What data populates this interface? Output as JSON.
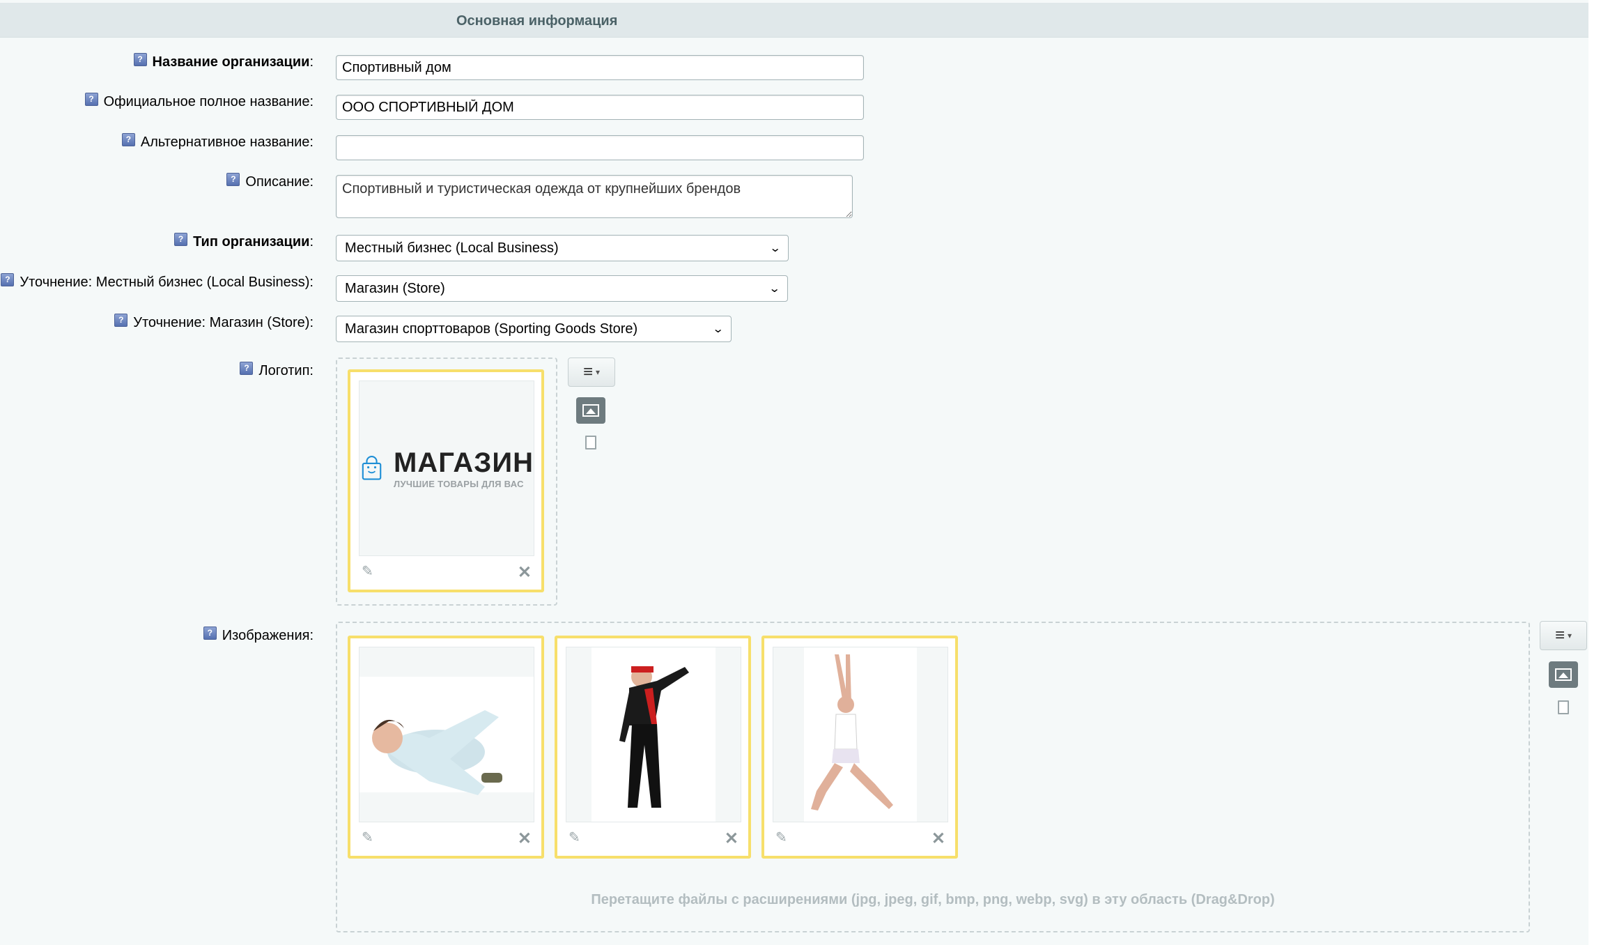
{
  "section": {
    "title": "Основная информация"
  },
  "fields": {
    "org_name": {
      "label": "Название организации",
      "colon": ":",
      "value": "Спортивный дом"
    },
    "official_name": {
      "label": "Официальное полное название:",
      "value": "ООО СПОРТИВНЫЙ ДОМ"
    },
    "alt_name": {
      "label": "Альтернативное название:",
      "value": ""
    },
    "description": {
      "label": "Описание:",
      "value": "Спортивный и туристическая одежда от крупнейших брендов"
    },
    "org_type": {
      "label": "Тип организации",
      "colon": ":",
      "value": "Местный бизнес (Local Business)"
    },
    "refine_local": {
      "label": "Уточнение: Местный бизнес (Local Business):",
      "value": "Магазин (Store)"
    },
    "refine_store": {
      "label": "Уточнение: Магазин (Store):",
      "value": "Магазин спорттоваров (Sporting Goods Store)"
    },
    "logo": {
      "label": "Логотип:",
      "logo_text": "МАГАЗИН",
      "logo_subtext": "ЛУЧШИЕ ТОВАРЫ ДЛЯ ВАС"
    },
    "images": {
      "label": "Изображения:",
      "items": [
        {
          "name": "image-woman-reclining"
        },
        {
          "name": "image-woman-stretching"
        },
        {
          "name": "image-woman-yoga"
        }
      ],
      "drop_hint": "Перетащите файлы с расширениями (jpg, jpeg, gif, bmp, png, webp, svg) в эту область (Drag&Drop)"
    }
  },
  "icons": {
    "hint": "?",
    "edit": "✎",
    "delete": "✕",
    "menu": "≡",
    "caret": "▾",
    "chevron": "⌄"
  },
  "colors": {
    "card_border": "#f7df6b",
    "header_bg": "#e0e8ea",
    "logo_blue": "#1f8fd6"
  }
}
